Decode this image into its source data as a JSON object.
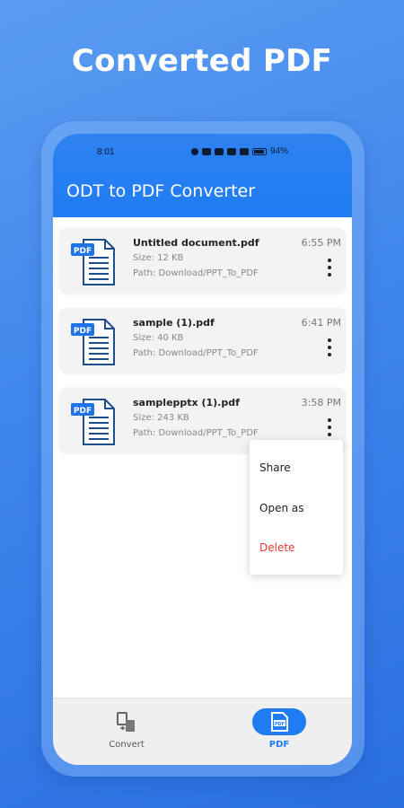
{
  "promo": {
    "title": "Converted PDF"
  },
  "status_bar": {
    "time": "8:01",
    "battery": "94%"
  },
  "app_bar": {
    "title": "ODT to PDF Converter"
  },
  "files": [
    {
      "name": "Untitled document.pdf",
      "size": "Size: 12 KB",
      "path": "Path: Download/PPT_To_PDF",
      "time": "6:55 PM",
      "icon": "pdf-file-icon"
    },
    {
      "name": "sample (1).pdf",
      "size": "Size: 40 KB",
      "path": "Path: Download/PPT_To_PDF",
      "time": "6:41 PM",
      "icon": "pdf-file-icon"
    },
    {
      "name": "samplepptx (1).pdf",
      "size": "Size: 243 KB",
      "path": "Path: Download/PPT_To_PDF",
      "time": "3:58 PM",
      "icon": "pdf-file-icon"
    }
  ],
  "popup_menu": {
    "items": [
      {
        "label": "Share"
      },
      {
        "label": "Open as"
      },
      {
        "label": "Delete"
      }
    ]
  },
  "bottom_nav": {
    "items": [
      {
        "label": "Convert",
        "icon": "convert-icon",
        "active": false
      },
      {
        "label": "PDF",
        "icon": "pdf-icon",
        "active": true
      }
    ]
  },
  "colors": {
    "accent": "#1F7CF3",
    "background_gradient": [
      "#5A9CF2",
      "#2B6FE0"
    ],
    "delete": "#E53935"
  }
}
